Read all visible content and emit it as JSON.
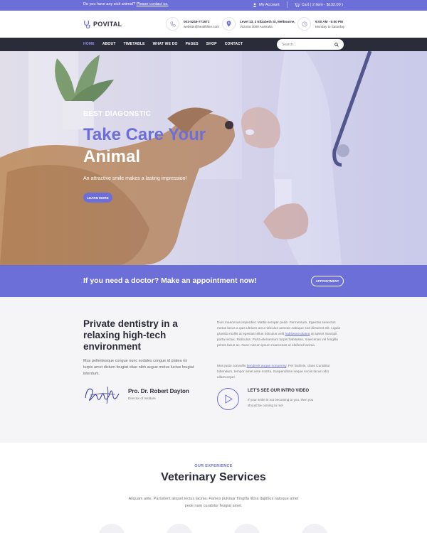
{
  "topbar": {
    "promo_prefix": "Do you have any sick animal?",
    "promo_link": "Please contact us.",
    "account": "My Account",
    "cart": "Cart ( 2 item - $132.00 )"
  },
  "header": {
    "logo": "POVITAL",
    "phone": "001-5249-771571",
    "email": "website@healthline.com",
    "address_line1": "Level 13, 2 Elizabeth St, Melbourne,",
    "address_line2": "Victoria 3000 Australia",
    "hours": "9:00 AM - 5:00 PM",
    "days": "Monday to Saturday"
  },
  "nav": {
    "items": [
      "HOME",
      "ABOUT",
      "TIMETABLE",
      "WHAT WE DO",
      "PAGES",
      "SHOP",
      "CONTACT"
    ],
    "search_placeholder": "Search..."
  },
  "hero": {
    "subtitle": "BEST DIAGONSTIC",
    "title_line1": "Take Care Your",
    "title_line2": "Animal",
    "description": "An attractive smile makes a lasting impression!",
    "button": "LEARN MORE"
  },
  "band": {
    "text": "If you need a doctor? Make an appointment now!",
    "button": "APPOINTMENT"
  },
  "about": {
    "title": "Private dentistry in a relaxing high-tech environment",
    "lead": "Mus pellentesque congue nunc sodales congue id platea mi turpis amet dictum feugiat vitae nibh augue metus luctus feugiat interdum.",
    "doctor_name": "Pro. Dr. Robert Dayton",
    "doctor_role": "Director of Institure",
    "p1_before": "Duis maecenas imperdiet. Mattis semper pede. Fermentum. Egestas senectus metus lacus a quis ultrices arcu ridiculus aenean natoque sed dictumst elit. Ligula gravida mollis at egestas tellus ridiculus velit ",
    "p1_link": "habitasse platea",
    "p1_after": " at aptent Suscipit porta lectus. Ridiculus. Porta elementum turpis habitasse, maecenas vel fringilla primis lacus ac. Nunc rutrum ipsum maecenas ut eleifend lacinia.",
    "p2_before": "Mus justo convallis ",
    "p2_link": "hendrerit augue nonummy",
    "p2_after": ". Per facilisis, class Curabitur bibendum, tempor amet ante nostra. Suspendisse neque sociis lacus odio ullamcorper.",
    "intro_title": "LET'S SEE OUR INTRO VIDEO",
    "intro_text": "If your smile is not becoming to you, then you should be coming to me!"
  },
  "services": {
    "eyebrow": "OUR EXPERIENCE",
    "title": "Veterinary Services",
    "description": "Aliquam ante. Parturient aliquet lectus lacinia. Fames pulvinar fringilla litora dapibus natoque amet pede nam curabitur feugiat amet."
  },
  "colors": {
    "accent": "#6d6fd8",
    "nav_bg": "#2b2c3a",
    "section_bg": "#f5f5f7"
  }
}
